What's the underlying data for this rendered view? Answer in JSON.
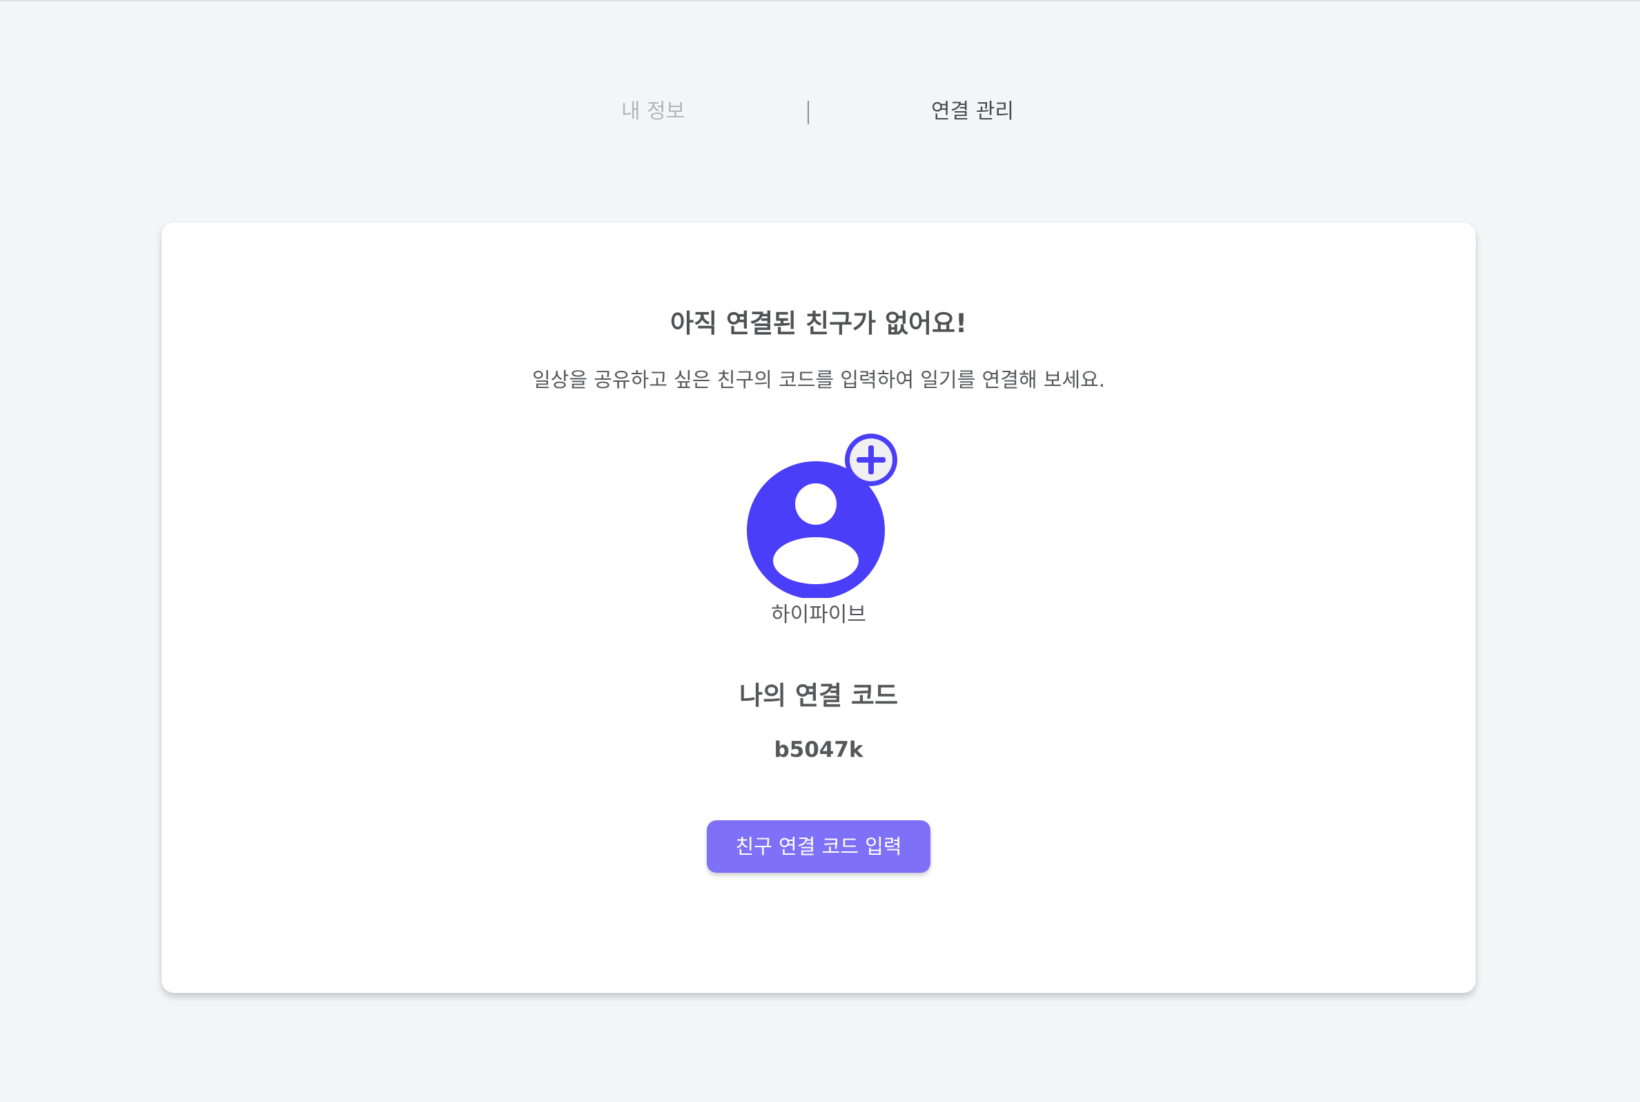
{
  "tabs": {
    "profile_label": "내 정보",
    "connection_label": "연결 관리"
  },
  "empty_state": {
    "title": "아직 연결된 친구가 없어요!",
    "description": "일상을 공유하고 싶은 친구의 코드를 입력하여 일기를 연결해 보세요."
  },
  "profile": {
    "avatar_icon": "user-circle-icon",
    "add_icon": "plus-circle-icon",
    "username": "하이파이브"
  },
  "connection_code": {
    "label": "나의 연결 코드",
    "value": "b5047k"
  },
  "actions": {
    "enter_code_label": "친구 연결 코드 입력"
  },
  "colors": {
    "accent": "#4a3ef8",
    "button": "#7f70f8",
    "background": "#f4f5f7"
  }
}
